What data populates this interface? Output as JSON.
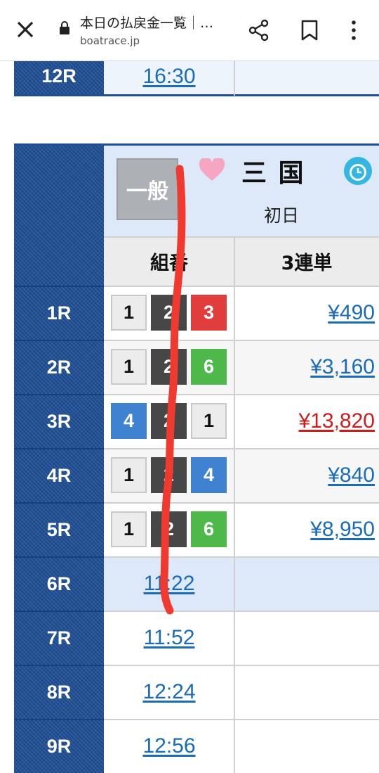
{
  "browser": {
    "title": "本日の払戻金一覧｜…",
    "url": "boatrace.jp",
    "icons": [
      "close-icon",
      "lock-icon",
      "share-icon",
      "bookmark-icon",
      "more-vert-icon"
    ]
  },
  "prev_table": {
    "race": "12R",
    "time": "16:30"
  },
  "venue": {
    "grade_badge": "一般",
    "name": "三 国",
    "day": "初日",
    "icons": [
      "heart-icon",
      "alarm-clock-icon"
    ]
  },
  "headers": {
    "combination": "組番",
    "trifecta": "3連単"
  },
  "races": [
    {
      "race": "1R",
      "combo": [
        "1",
        "2",
        "3"
      ],
      "payout": "¥490"
    },
    {
      "race": "2R",
      "combo": [
        "1",
        "2",
        "6"
      ],
      "payout": "¥3,160"
    },
    {
      "race": "3R",
      "combo": [
        "4",
        "2",
        "1"
      ],
      "payout": "¥13,820"
    },
    {
      "race": "4R",
      "combo": [
        "1",
        "2",
        "4"
      ],
      "payout": "¥840"
    },
    {
      "race": "5R",
      "combo": [
        "1",
        "2",
        "6"
      ],
      "payout": "¥8,950"
    },
    {
      "race": "6R",
      "time": "11:22"
    },
    {
      "race": "7R",
      "time": "11:52"
    },
    {
      "race": "8R",
      "time": "12:24"
    },
    {
      "race": "9R",
      "time": "12:56"
    }
  ],
  "colors": {
    "navy": "#1e4f96",
    "link": "#1a6bb8",
    "high_payout": "#c81e1e",
    "box_1": "#ececec",
    "box_2": "#474747",
    "box_3": "#e23d3d",
    "box_4": "#3f82d2",
    "box_6": "#4fb84a",
    "scribble": "#f0392f"
  }
}
